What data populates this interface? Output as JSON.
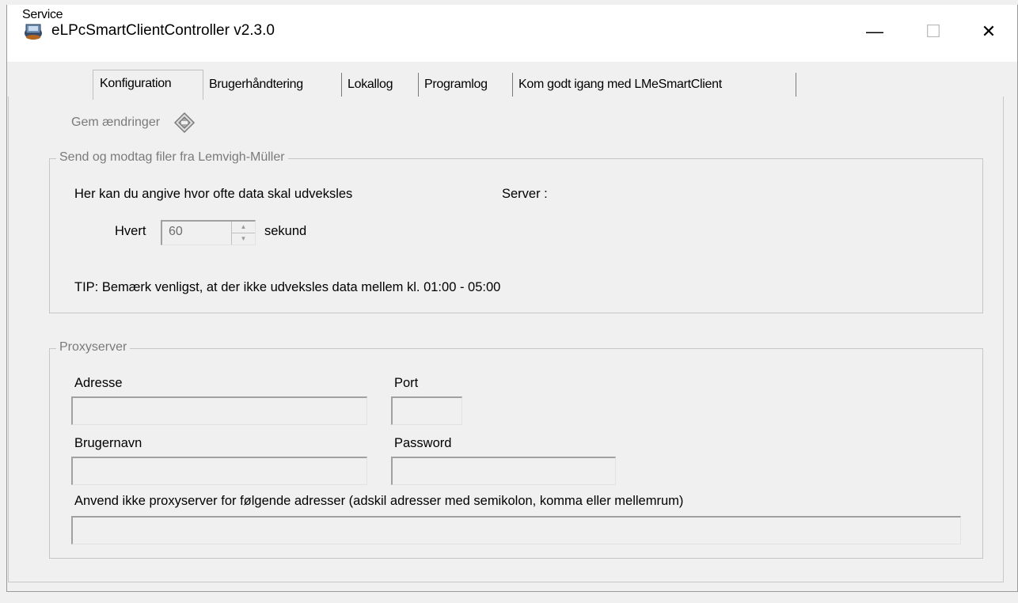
{
  "window": {
    "title": "eLPcSmartClientController v2.3.0",
    "controls": {
      "minimize": "—",
      "maximize": "☐",
      "close": "✕"
    }
  },
  "tabs": [
    {
      "label": "Service"
    },
    {
      "label": "Konfiguration",
      "active": true
    },
    {
      "label": "Brugerhåndtering"
    },
    {
      "label": "Lokallog"
    },
    {
      "label": "Programlog"
    },
    {
      "label": "Kom godt igang med LMeSmartClient"
    }
  ],
  "toolbar": {
    "save_label": "Gem ændringer",
    "save_icon": "save-diamond-icon"
  },
  "exchange_group": {
    "legend": "Send og modtag filer fra Lemvigh-Müller",
    "description": "Her kan du angive hvor ofte data skal udveksles",
    "server_label": "Server :",
    "interval_prefix": "Hvert",
    "interval_value": "60",
    "interval_suffix": "sekund",
    "tip": "TIP: Bemærk venligst, at der ikke udveksles data mellem kl. 01:00 - 05:00"
  },
  "proxy_group": {
    "legend": "Proxyserver",
    "address_label": "Adresse",
    "address_value": "",
    "port_label": "Port",
    "port_value": "",
    "username_label": "Brugernavn",
    "username_value": "",
    "password_label": "Password",
    "password_value": "",
    "bypass_label": "Anvend ikke proxyserver for følgende adresser (adskil adresser med semikolon, komma eller mellemrum)",
    "bypass_value": ""
  },
  "colors": {
    "window_bg": "#f0f0f0",
    "titlebar_bg": "#ffffff",
    "disabled_text": "#7a7a7a"
  }
}
